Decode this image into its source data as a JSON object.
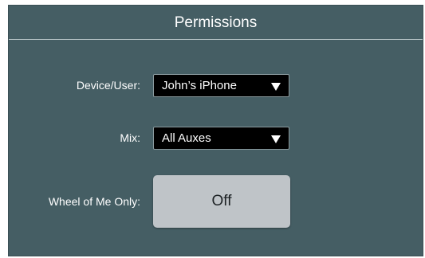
{
  "panel": {
    "title": "Permissions"
  },
  "device_user": {
    "label": "Device/User:",
    "value": "John’s iPhone",
    "icon": "chevron-down-icon"
  },
  "mix": {
    "label": "Mix:",
    "value": "All Auxes",
    "icon": "chevron-down-icon"
  },
  "wheel_of_me": {
    "label": "Wheel of Me Only:",
    "value": "Off"
  },
  "colors": {
    "panel_background": "#455e64",
    "select_background": "#000000",
    "toggle_background": "#bfc4c8",
    "text": "#ffffff"
  }
}
